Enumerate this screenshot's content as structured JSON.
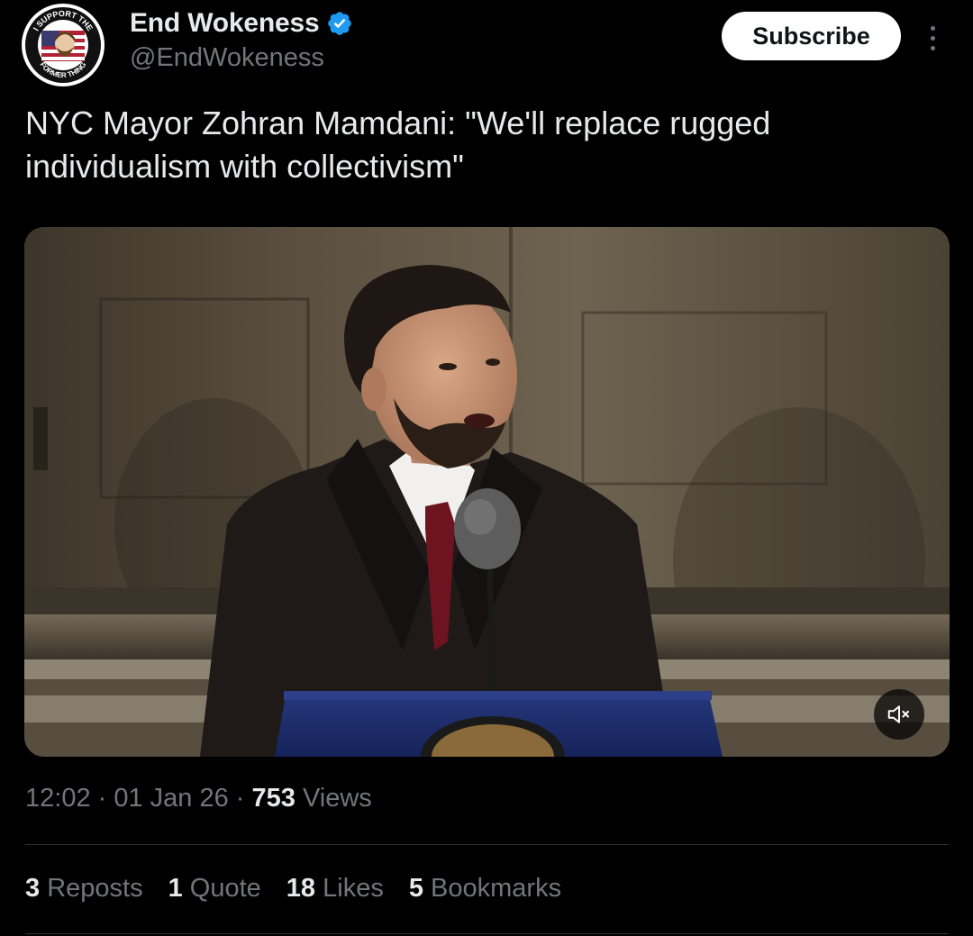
{
  "author": {
    "display_name": "End Wokeness",
    "handle": "@EndWokeness",
    "avatar_icon": "patch-logo-icon",
    "avatar_top_text": "I SUPPORT THE",
    "avatar_bottom_text": "FORMER THING",
    "verified_color": "#1d9bf0"
  },
  "actions": {
    "subscribe_label": "Subscribe",
    "more_icon": "more-vertical-icon"
  },
  "post": {
    "text": "NYC Mayor Zohran Mamdani: \"We'll replace rugged individualism with collectivism\""
  },
  "media": {
    "type": "video",
    "mute_icon": "volume-muted-icon"
  },
  "meta": {
    "time": "12:02",
    "sep1": " · ",
    "date": "01 Jan 26",
    "sep2": " · ",
    "views_count": "753",
    "views_label": " Views"
  },
  "stats": [
    {
      "count": "3",
      "label": " Reposts"
    },
    {
      "count": "1",
      "label": " Quote"
    },
    {
      "count": "18",
      "label": " Likes"
    },
    {
      "count": "5",
      "label": " Bookmarks"
    }
  ],
  "colors": {
    "background": "#000000",
    "text_primary": "#e7e9ea",
    "text_secondary": "#71767b",
    "divider": "#2f3336",
    "accent": "#1d9bf0"
  }
}
